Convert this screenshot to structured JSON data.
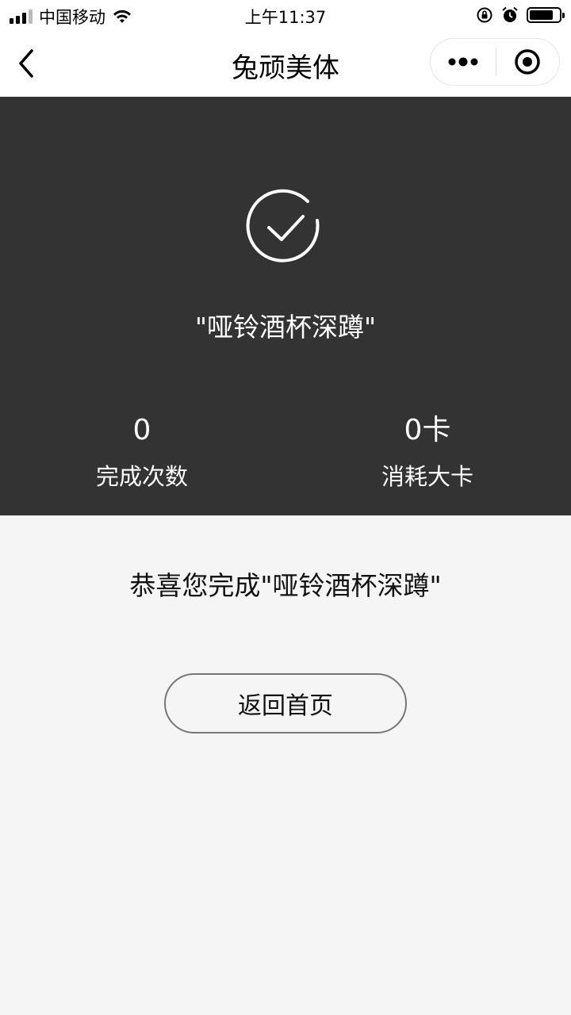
{
  "status_bar": {
    "carrier": "中国移动",
    "time": "上午11:37",
    "battery_level": 0.8
  },
  "nav": {
    "title": "兔顽美体",
    "back_icon": "chevron-left-icon",
    "more_icon": "more-dots-icon",
    "close_icon": "target-circle-icon"
  },
  "result": {
    "icon": "check-circle-icon",
    "exercise_name": "\"哑铃酒杯深蹲\"",
    "stats": [
      {
        "value": "0",
        "label": "完成次数"
      },
      {
        "value": "0卡",
        "label": "消耗大卡"
      }
    ]
  },
  "congrats_text": "恭喜您完成\"哑铃酒杯深蹲\"",
  "home_button_label": "返回首页",
  "colors": {
    "panel_bg": "#333333",
    "page_bg": "#f5f5f5",
    "nav_bg": "#ffffff"
  }
}
